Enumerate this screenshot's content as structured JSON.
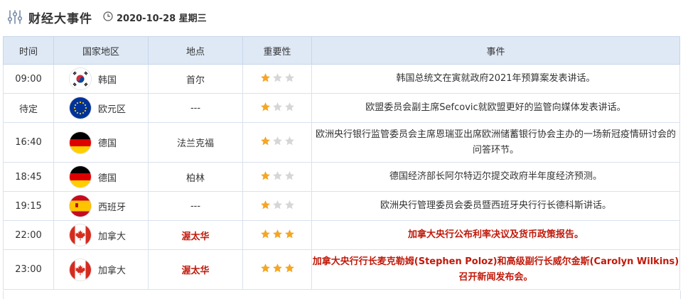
{
  "header": {
    "title": "财经大事件",
    "date": "2020-10-28 星期三"
  },
  "table": {
    "columns": [
      "时间",
      "国家地区",
      "地点",
      "重要性",
      "事件"
    ],
    "rows": [
      {
        "time": "09:00",
        "flag": "south-korea-flag-icon",
        "country": "韩国",
        "city": "首尔",
        "stars": 1,
        "event": "韩国总统文在寅就政府2021年预算案发表讲话。",
        "important": false
      },
      {
        "time": "待定",
        "flag": "eu-flag-icon",
        "country": "欧元区",
        "city": "---",
        "stars": 1,
        "event": "欧盟委员会副主席Sefcovic就欧盟更好的监管向媒体发表讲话。",
        "important": false
      },
      {
        "time": "16:40",
        "flag": "germany-flag-icon",
        "country": "德国",
        "city": "法兰克福",
        "stars": 1,
        "event": "欧洲央行银行监管委员会主席恩瑞亚出席欧洲储蓄银行协会主办的一场新冠疫情研讨会的问答环节。",
        "important": false
      },
      {
        "time": "18:45",
        "flag": "germany-flag-icon",
        "country": "德国",
        "city": "柏林",
        "stars": 1,
        "event": "德国经济部长阿尔特迈尔提交政府半年度经济预测。",
        "important": false
      },
      {
        "time": "19:15",
        "flag": "spain-flag-icon",
        "country": "西班牙",
        "city": "---",
        "stars": 1,
        "event": "欧洲央行管理委员会委员暨西班牙央行行长德科斯讲话。",
        "important": false
      },
      {
        "time": "22:00",
        "flag": "canada-flag-icon",
        "country": "加拿大",
        "city": "渥太华",
        "stars": 3,
        "event": "加拿大央行公布利率决议及货币政策报告。",
        "important": true
      },
      {
        "time": "23:00",
        "flag": "canada-flag-icon",
        "country": "加拿大",
        "city": "渥太华",
        "stars": 3,
        "event": "加拿大央行行长麦克勒姆(Stephen Poloz)和高级副行长威尔金斯(Carolyn Wilkins)召开新闻发布会。",
        "important": true
      }
    ]
  },
  "colors": {
    "header_bg": "#dfe9f6",
    "star_active": "#f5a623",
    "star_inactive": "#d6d6d6",
    "important_text": "#c0190a"
  }
}
